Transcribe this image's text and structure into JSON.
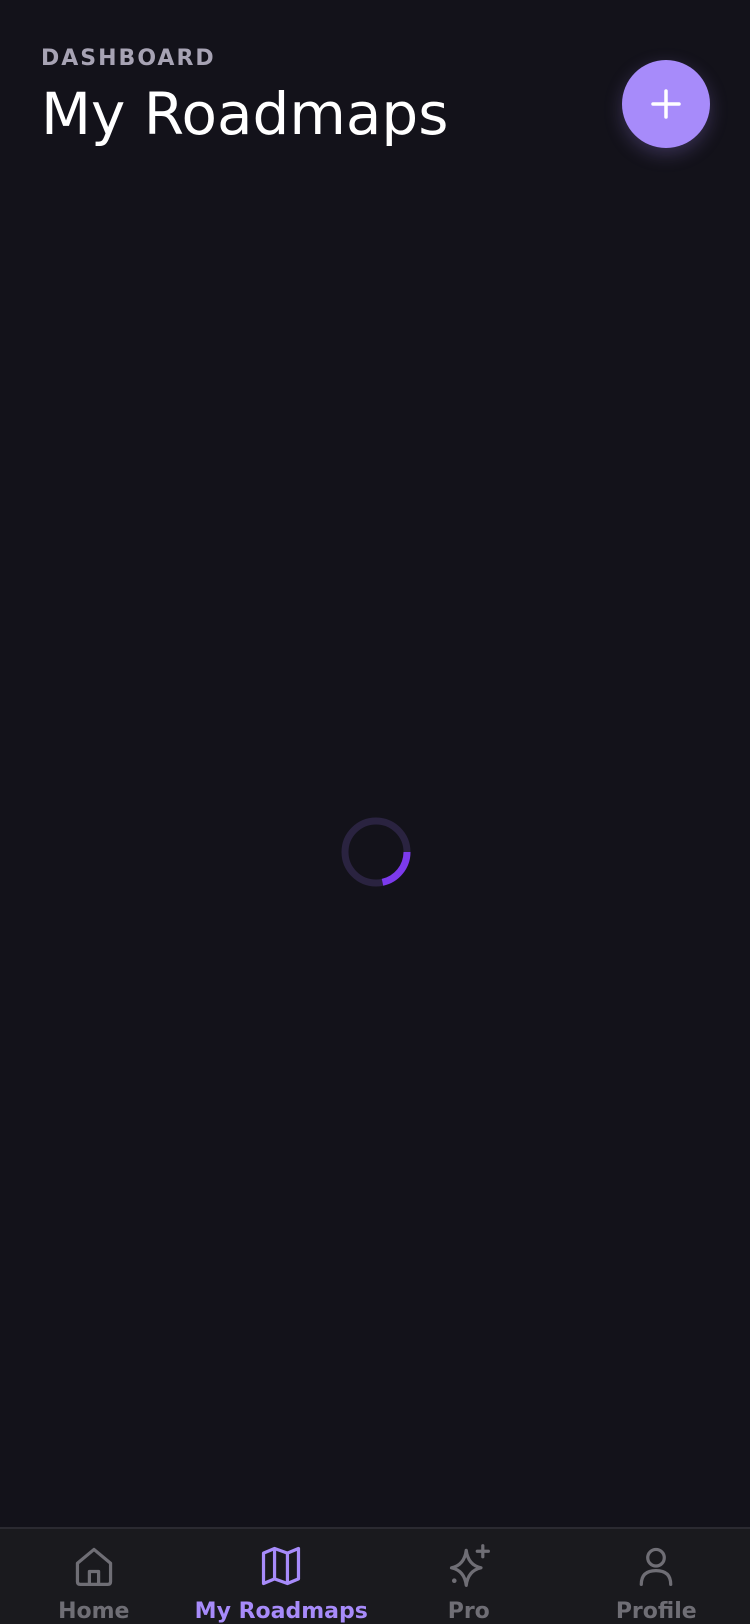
{
  "header": {
    "eyebrow": "DASHBOARD",
    "title": "My Roadmaps"
  },
  "fab": {
    "icon": "plus-icon"
  },
  "loading": {
    "icon": "loading-spinner"
  },
  "tabbar": {
    "active_color": "#a78bfa",
    "inactive_color": "#6f6e75",
    "items": [
      {
        "label": "Home",
        "icon": "home-icon",
        "active": false
      },
      {
        "label": "My Roadmaps",
        "icon": "map-icon",
        "active": true
      },
      {
        "label": "Pro",
        "icon": "sparkle-icon",
        "active": false
      },
      {
        "label": "Profile",
        "icon": "user-icon",
        "active": false
      }
    ]
  },
  "colors": {
    "background": "#13121a",
    "accent": "#a78bfa",
    "spinner_track": "#2a2340",
    "spinner_arc": "#7c3aed"
  }
}
